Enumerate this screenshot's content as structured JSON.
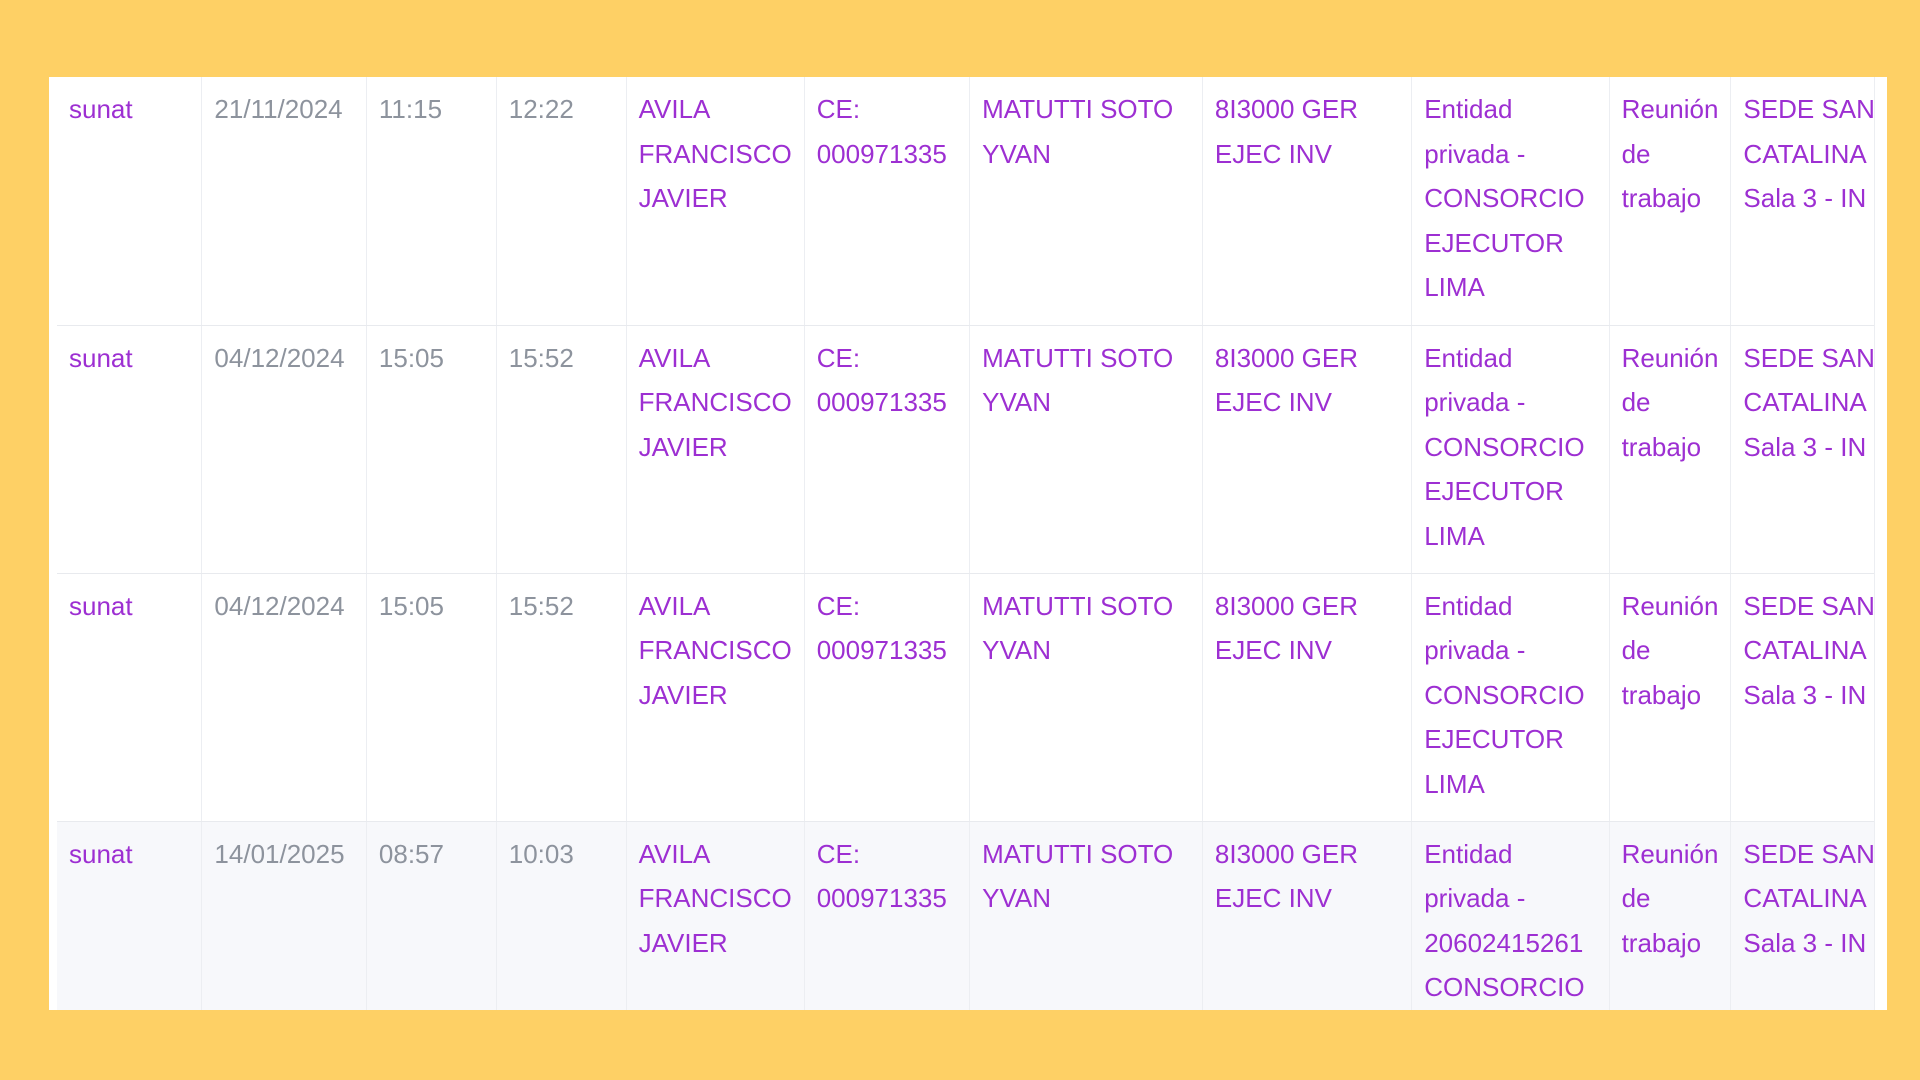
{
  "table": {
    "rows": [
      {
        "entity": "sunat",
        "date": "21/11/2024",
        "start": "11:15",
        "end": "12:22",
        "visitor": "AVILA FRANCISCO JAVIER",
        "document": "CE: 000971335",
        "host": "MATUTTI SOTO YVAN",
        "office": "8I3000 GER EJEC INV",
        "institution": "Entidad privada - CONSORCIO EJECUTOR LIMA",
        "reason": "Reunión de trabajo",
        "location_lines": [
          "SEDE SAN",
          "CATALINA",
          "Sala 3 - IN"
        ]
      },
      {
        "entity": "sunat",
        "date": "04/12/2024",
        "start": "15:05",
        "end": "15:52",
        "visitor": "AVILA FRANCISCO JAVIER",
        "document": "CE: 000971335",
        "host": "MATUTTI SOTO YVAN",
        "office": "8I3000 GER EJEC INV",
        "institution": "Entidad privada - CONSORCIO EJECUTOR LIMA",
        "reason": "Reunión de trabajo",
        "location_lines": [
          "SEDE SAN",
          "CATALINA",
          "Sala 3 - IN"
        ]
      },
      {
        "entity": "sunat",
        "date": "04/12/2024",
        "start": "15:05",
        "end": "15:52",
        "visitor": "AVILA FRANCISCO JAVIER",
        "document": "CE: 000971335",
        "host": "MATUTTI SOTO YVAN",
        "office": "8I3000 GER EJEC INV",
        "institution": "Entidad privada - CONSORCIO EJECUTOR LIMA",
        "reason": "Reunión de trabajo",
        "location_lines": [
          "SEDE SAN",
          "CATALINA",
          "Sala 3 - IN"
        ]
      },
      {
        "entity": "sunat",
        "date": "14/01/2025",
        "start": "08:57",
        "end": "10:03",
        "visitor": "AVILA FRANCISCO JAVIER",
        "document": "CE: 000971335",
        "host": "MATUTTI SOTO YVAN",
        "office": "8I3000 GER EJEC INV",
        "institution": "Entidad privada - 20602415261 CONSORCIO",
        "reason": "Reunión de trabajo",
        "location_lines": [
          "SEDE SAN",
          "CATALINA",
          "Sala 3 - IN"
        ]
      }
    ]
  },
  "colors": {
    "background": "#FED065",
    "link_text": "#9d2fd2",
    "muted_text": "#8d939d"
  }
}
